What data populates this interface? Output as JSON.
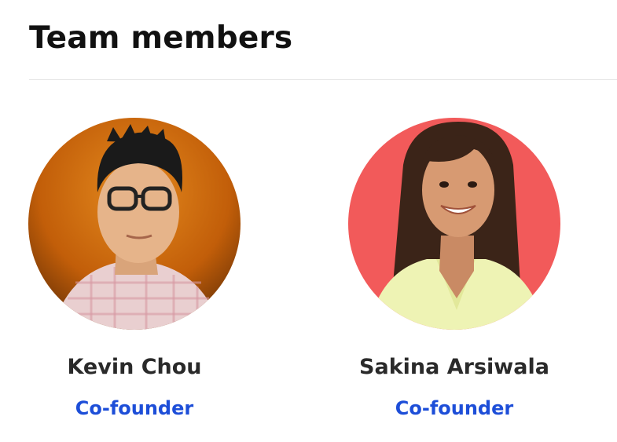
{
  "section": {
    "title": "Team members"
  },
  "members": [
    {
      "name": "Kevin Chou",
      "role": "Co-founder",
      "photo": "portrait-photo"
    },
    {
      "name": "Sakina Arsiwala",
      "role": "Co-founder",
      "photo": "portrait-photo"
    }
  ],
  "colors": {
    "role_link": "#1d4ed8",
    "title_text": "#111111",
    "divider": "#e5e5e5",
    "avatar1_bg": "#c9600a",
    "avatar2_bg": "#f25a5a"
  }
}
